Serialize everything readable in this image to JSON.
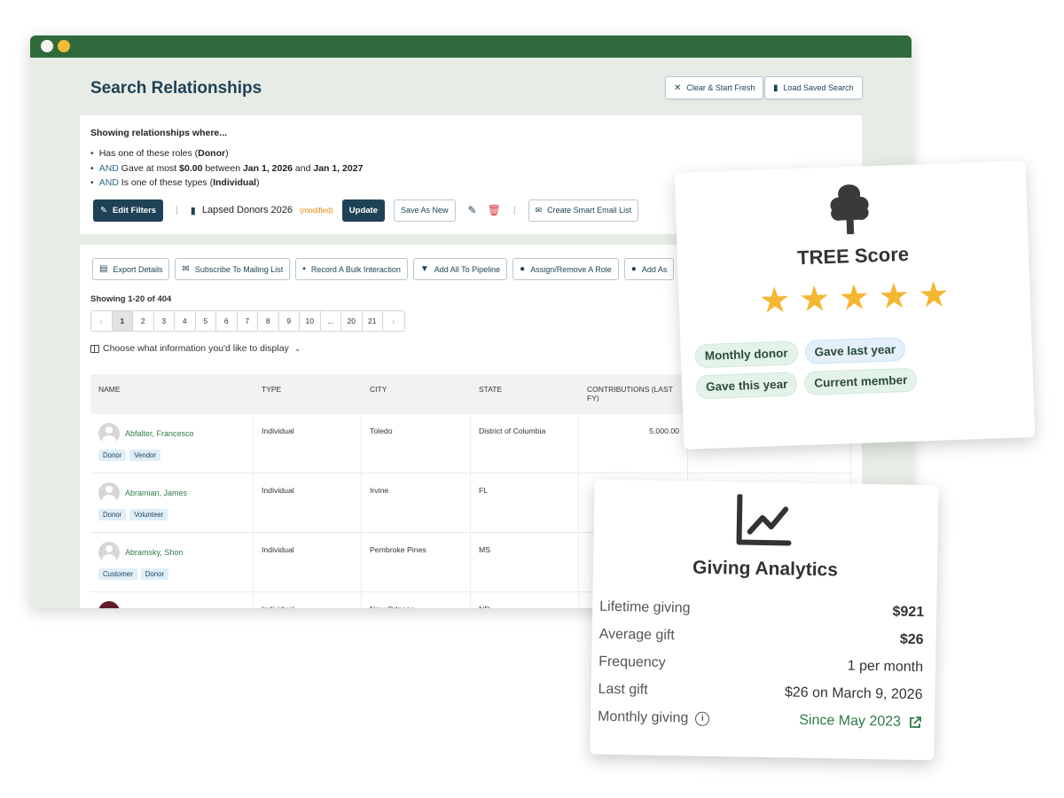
{
  "window": {
    "title": "Search Relationships"
  },
  "header": {
    "clear_label": "Clear & Start Fresh",
    "load_label": "Load Saved Search"
  },
  "filters": {
    "heading": "Showing relationships where...",
    "criteria": [
      {
        "prefix": "",
        "text": "Has one of these roles (",
        "bold": "Donor",
        "suffix": ")"
      },
      {
        "prefix": "AND",
        "text": "Gave at most ",
        "bold": "$0.00",
        "mid": " between ",
        "bold2": "Jan 1, 2026",
        "mid2": " and ",
        "bold3": "Jan 1, 2027"
      },
      {
        "prefix": "AND",
        "text": "Is one of these types (",
        "bold": "Individual",
        "suffix": ")"
      }
    ],
    "edit_label": "Edit Filters",
    "saved_search_name": "Lapsed Donors 2026",
    "modified_label": "(modified)",
    "update_label": "Update",
    "save_as_new_label": "Save As New",
    "smart_list_label": "Create Smart Email List"
  },
  "actions": [
    "Export Details",
    "Subscribe To Mailing List",
    "Record A Bulk Interaction",
    "Add All To Pipeline",
    "Assign/Remove A Role",
    "Add As"
  ],
  "results": {
    "showing": "Showing 1-20 of 404",
    "pages": [
      "‹",
      "1",
      "2",
      "3",
      "4",
      "5",
      "6",
      "7",
      "8",
      "9",
      "10",
      "...",
      "20",
      "21",
      "›"
    ],
    "active_page": "1",
    "choose_label": "Choose what information you'd like to display"
  },
  "table": {
    "headers": [
      "NAME",
      "TYPE",
      "CITY",
      "STATE",
      "CONTRIBUTIONS (LAST FY)",
      ""
    ],
    "rows": [
      {
        "name": "Abfalter, Francesco",
        "tags": [
          "Donor",
          "Vendor"
        ],
        "type": "Individual",
        "city": "Toledo",
        "state": "District of Columbia",
        "contrib": "5,000.00"
      },
      {
        "name": "Abramian, James",
        "tags": [
          "Donor",
          "Volunteer"
        ],
        "type": "Individual",
        "city": "Irvine",
        "state": "FL",
        "contrib": ""
      },
      {
        "name": "Abramsky, Shon",
        "tags": [
          "Customer",
          "Donor"
        ],
        "type": "Individual",
        "city": "Pembroke Pines",
        "state": "MS",
        "contrib": ""
      },
      {
        "name": "",
        "tags": [],
        "type": "Individual",
        "city": "New Orleans",
        "state": "ND",
        "contrib": ""
      }
    ]
  },
  "tree_card": {
    "title": "TREE Score",
    "stars": 5,
    "chips": [
      "Monthly donor",
      "Gave last year",
      "Gave this year",
      "Current member"
    ]
  },
  "giving_card": {
    "title": "Giving Analytics",
    "rows": [
      {
        "label": "Lifetime giving",
        "value": "$921"
      },
      {
        "label": "Average gift",
        "value": "$26"
      },
      {
        "label": "Frequency",
        "value": "1 per month"
      },
      {
        "label": "Last gift",
        "value": "$26 on March 9, 2026"
      },
      {
        "label": "Monthly giving",
        "value": "Since May 2023"
      }
    ]
  },
  "colors": {
    "titlebar": "#2f6a3c",
    "primary": "#1f4256",
    "link_green": "#2f7a4a",
    "star": "#f5b731",
    "modified": "#e4870c"
  }
}
